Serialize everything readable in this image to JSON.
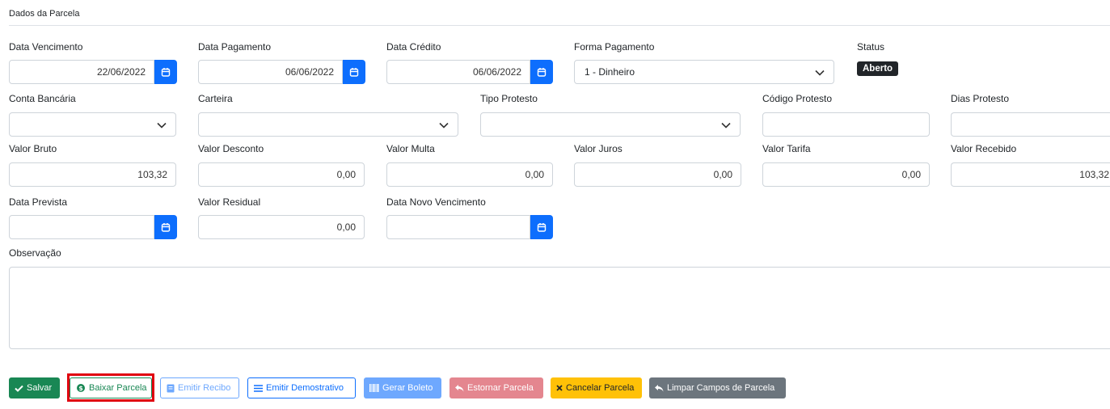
{
  "section": {
    "title": "Dados da Parcela"
  },
  "row1": {
    "data_vencimento": {
      "label": "Data Vencimento",
      "value": "22/06/2022"
    },
    "data_pagamento": {
      "label": "Data Pagamento",
      "value": "06/06/2022"
    },
    "data_credito": {
      "label": "Data Crédito",
      "value": "06/06/2022"
    },
    "forma_pagamento": {
      "label": "Forma Pagamento",
      "value": "1 - Dinheiro"
    },
    "status": {
      "label": "Status",
      "value": "Aberto"
    }
  },
  "row2": {
    "conta_bancaria": {
      "label": "Conta Bancária",
      "value": ""
    },
    "carteira": {
      "label": "Carteira",
      "value": ""
    },
    "tipo_protesto": {
      "label": "Tipo Protesto",
      "value": ""
    },
    "codigo_protesto": {
      "label": "Código Protesto",
      "value": ""
    },
    "dias_protesto": {
      "label": "Dias Protesto",
      "value": ""
    }
  },
  "row3": {
    "valor_bruto": {
      "label": "Valor Bruto",
      "value": "103,32"
    },
    "valor_desconto": {
      "label": "Valor Desconto",
      "value": "0,00"
    },
    "valor_multa": {
      "label": "Valor Multa",
      "value": "0,00"
    },
    "valor_juros": {
      "label": "Valor Juros",
      "value": "0,00"
    },
    "valor_tarifa": {
      "label": "Valor Tarifa",
      "value": "0,00"
    },
    "valor_recebido": {
      "label": "Valor Recebido",
      "value": "103,32"
    }
  },
  "row4": {
    "data_prevista": {
      "label": "Data Prevista",
      "value": ""
    },
    "valor_residual": {
      "label": "Valor Residual",
      "value": "0,00"
    },
    "data_novo_vencimento": {
      "label": "Data Novo Vencimento",
      "value": ""
    }
  },
  "observacao": {
    "label": "Observação",
    "value": ""
  },
  "buttons": {
    "salvar": "Salvar",
    "baixar_parcela": "Baixar Parcela",
    "emitir_recibo": "Emitir Recibo",
    "emitir_demonstrativo": "Emitir Demostrativo",
    "gerar_boleto": "Gerar Boleto",
    "estornar_parcela": "Estornar Parcela",
    "cancelar_parcela": "Cancelar Parcela",
    "limpar_campos": "Limpar Campos de Parcela"
  },
  "icons": {
    "calendar": "calendar-icon",
    "chevron": "chevron-down-icon",
    "check": "check-icon",
    "money": "money-icon",
    "receipt": "receipt-icon",
    "list": "list-icon",
    "barcode": "barcode-icon",
    "undo": "undo-icon",
    "close": "close-icon"
  },
  "colors": {
    "primary": "#0d6efd",
    "success": "#198754",
    "danger_light": "#e4868f",
    "warning": "#ffc107",
    "secondary": "#6c757d",
    "info_light": "#6ea8fe",
    "dark": "#212529",
    "highlight": "#e0000f"
  }
}
